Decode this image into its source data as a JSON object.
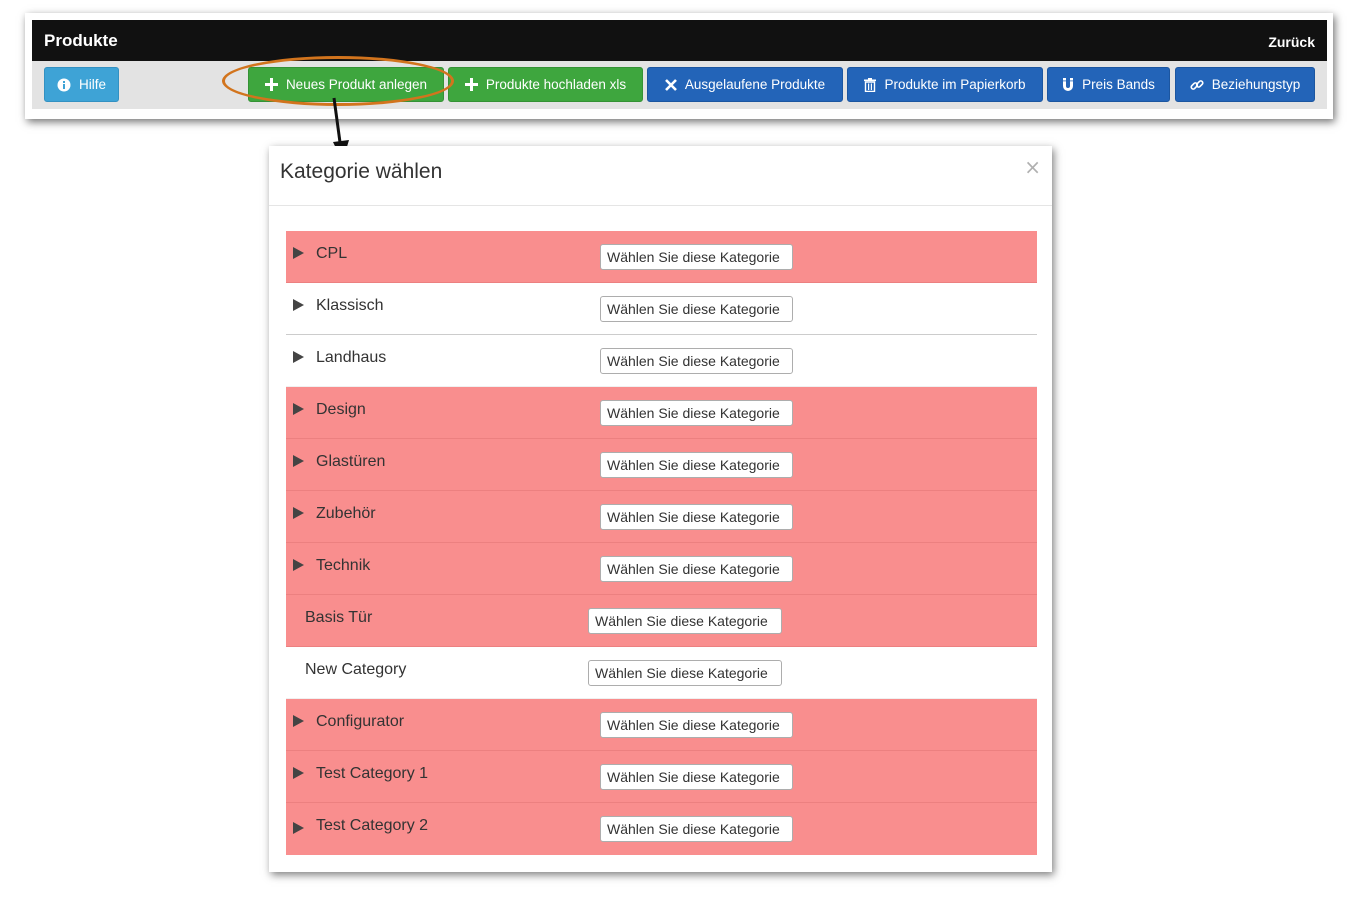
{
  "header": {
    "title": "Produkte",
    "back_label": "Zurück"
  },
  "toolbar": {
    "buttons": [
      {
        "label": "Hilfe",
        "icon": "info-circle-icon",
        "color": "#3ea3d6"
      },
      {
        "label": "Neues Produkt anlegen",
        "icon": "plus-icon",
        "color": "#3ea63e"
      },
      {
        "label": "Produkte hochladen xls",
        "icon": "plus-icon",
        "color": "#3ea63e"
      },
      {
        "label": "Ausgelaufene Produkte",
        "icon": "x-icon",
        "color": "#2364b8"
      },
      {
        "label": "Produkte im Papierkorb",
        "icon": "trash-icon",
        "color": "#2364b8"
      },
      {
        "label": "Preis Bands",
        "icon": "magnet-icon",
        "color": "#2364b8"
      },
      {
        "label": "Beziehungstyp",
        "icon": "link-icon",
        "color": "#2364b8"
      }
    ]
  },
  "annotation": {
    "highlight_color": "#d2741d"
  },
  "modal": {
    "title": "Kategorie wählen",
    "close_glyph": "×",
    "categories": [
      {
        "name": "CPL",
        "button_label": "Wählen Sie diese Kategorie",
        "row_color": "#f98e8e",
        "expandable": true
      },
      {
        "name": "Klassisch",
        "button_label": "Wählen Sie diese Kategorie",
        "row_color": "#ffffff",
        "expandable": true
      },
      {
        "name": "Landhaus",
        "button_label": "Wählen Sie diese Kategorie",
        "row_color": "#ffffff",
        "expandable": true
      },
      {
        "name": "Design",
        "button_label": "Wählen Sie diese Kategorie",
        "row_color": "#f98e8e",
        "expandable": true
      },
      {
        "name": "Glastüren",
        "button_label": "Wählen Sie diese Kategorie",
        "row_color": "#f98e8e",
        "expandable": true
      },
      {
        "name": "Zubehör",
        "button_label": "Wählen Sie diese Kategorie",
        "row_color": "#f98e8e",
        "expandable": true
      },
      {
        "name": "Technik",
        "button_label": "Wählen Sie diese Kategorie",
        "row_color": "#f98e8e",
        "expandable": true
      },
      {
        "name": "Basis Tür",
        "button_label": "Wählen Sie diese Kategorie",
        "row_color": "#f98e8e",
        "expandable": false
      },
      {
        "name": "New Category",
        "button_label": "Wählen Sie diese Kategorie",
        "row_color": "#ffffff",
        "expandable": false
      },
      {
        "name": "Configurator",
        "button_label": "Wählen Sie diese Kategorie",
        "row_color": "#f98e8e",
        "expandable": true
      },
      {
        "name": "Test Category 1",
        "button_label": "Wählen Sie diese Kategorie",
        "row_color": "#f98e8e",
        "expandable": true
      },
      {
        "name": "Test Category 2",
        "button_label": "Wählen Sie diese Kategorie",
        "row_color": "#f98e8e",
        "expandable": true
      }
    ]
  }
}
